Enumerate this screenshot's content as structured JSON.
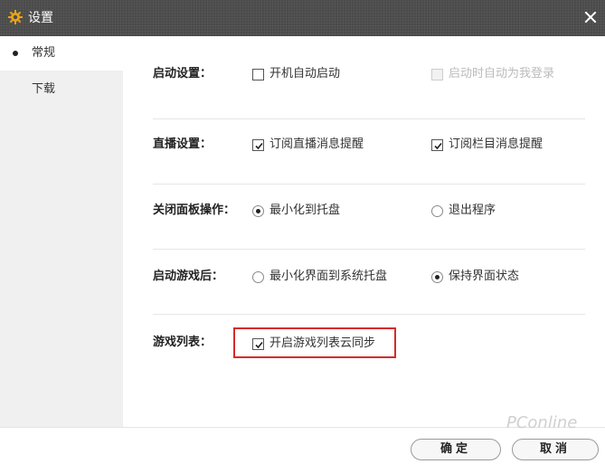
{
  "window": {
    "title": "设置",
    "title_icon": "gear-icon",
    "close_icon": "close-icon"
  },
  "sidebar": {
    "items": [
      {
        "label": "常规",
        "active": true
      },
      {
        "label": "下载",
        "active": false
      }
    ]
  },
  "settings": {
    "startup": {
      "label": "启动设置：",
      "options": [
        {
          "label": "开机自动启动",
          "type": "checkbox",
          "checked": false,
          "disabled": false
        },
        {
          "label": "启动时自动为我登录",
          "type": "checkbox",
          "checked": false,
          "disabled": true
        }
      ]
    },
    "live": {
      "label": "直播设置：",
      "options": [
        {
          "label": "订阅直播消息提醒",
          "type": "checkbox",
          "checked": true
        },
        {
          "label": "订阅栏目消息提醒",
          "type": "checkbox",
          "checked": true
        }
      ]
    },
    "close_panel": {
      "label": "关闭面板操作：",
      "options": [
        {
          "label": "最小化到托盘",
          "type": "radio",
          "selected": true
        },
        {
          "label": "退出程序",
          "type": "radio",
          "selected": false
        }
      ]
    },
    "after_launch": {
      "label": "启动游戏后：",
      "options": [
        {
          "label": "最小化界面到系统托盘",
          "type": "radio",
          "selected": false
        },
        {
          "label": "保持界面状态",
          "type": "radio",
          "selected": true
        }
      ]
    },
    "game_list": {
      "label": "游戏列表：",
      "options": [
        {
          "label": "开启游戏列表云同步",
          "type": "checkbox",
          "checked": true
        }
      ]
    }
  },
  "footer": {
    "ok_label": "确定",
    "cancel_label": "取消"
  },
  "watermark": "PConline",
  "colors": {
    "titlebar": "#4a4a4a",
    "sidebar": "#f0f0f0",
    "highlight": "#d62a2a",
    "gear": "#e8a317"
  }
}
